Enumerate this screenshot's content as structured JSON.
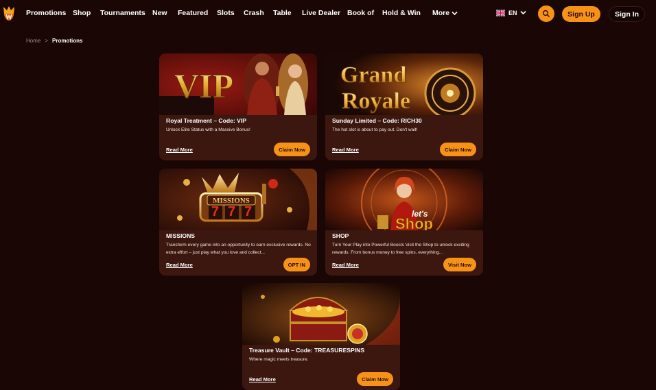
{
  "header": {
    "nav": [
      "Promotions",
      "Shop",
      "Tournaments",
      "New",
      "Featured",
      "Slots",
      "Crash",
      "Table",
      "Live Dealer",
      "Book of",
      "Hold & Win",
      "More"
    ],
    "language": "EN",
    "sign_up": "Sign Up",
    "sign_in": "Sign In",
    "accent": "#f79219"
  },
  "breadcrumb": {
    "home": "Home",
    "separator": ">",
    "current": "Promotions"
  },
  "promotions": [
    {
      "image_text": "VIP",
      "title": "Royal Treatment – Code: VIP",
      "description": "Unlock Elite Status with a Massive Bonus!",
      "read_more": "Read More",
      "cta": "Claim Now"
    },
    {
      "image_text": [
        "Grand",
        "Royale"
      ],
      "title": "Sunday Limited – Code: RICH30",
      "description": "The hot slot is about to pay out. Don't wait!",
      "read_more": "Read More",
      "cta": "Claim Now"
    },
    {
      "image_text": "MISSIONS",
      "title": "MISSIONS",
      "description": "Transform every game into an opportunity to earn exclusive rewards. No extra effort – just play what you love and collect...",
      "read_more": "Read More",
      "cta": "OPT IN"
    },
    {
      "image_text": [
        "let's",
        "Shop"
      ],
      "title": "SHOP",
      "description": "Turn Your Play into Powerful Boosts Visit the Shop to unlock exciting rewards. From bonus money to free spins, everything...",
      "read_more": "Read More",
      "cta": "Visit Now"
    },
    {
      "title": "Treasure Vault – Code: TREASURESPINS",
      "description": "Where magic meets treasure.",
      "read_more": "Read More",
      "cta": "Claim Now"
    }
  ],
  "colors": {
    "background": "#1a0604",
    "card": "#3c1710",
    "button": "#f79219"
  }
}
